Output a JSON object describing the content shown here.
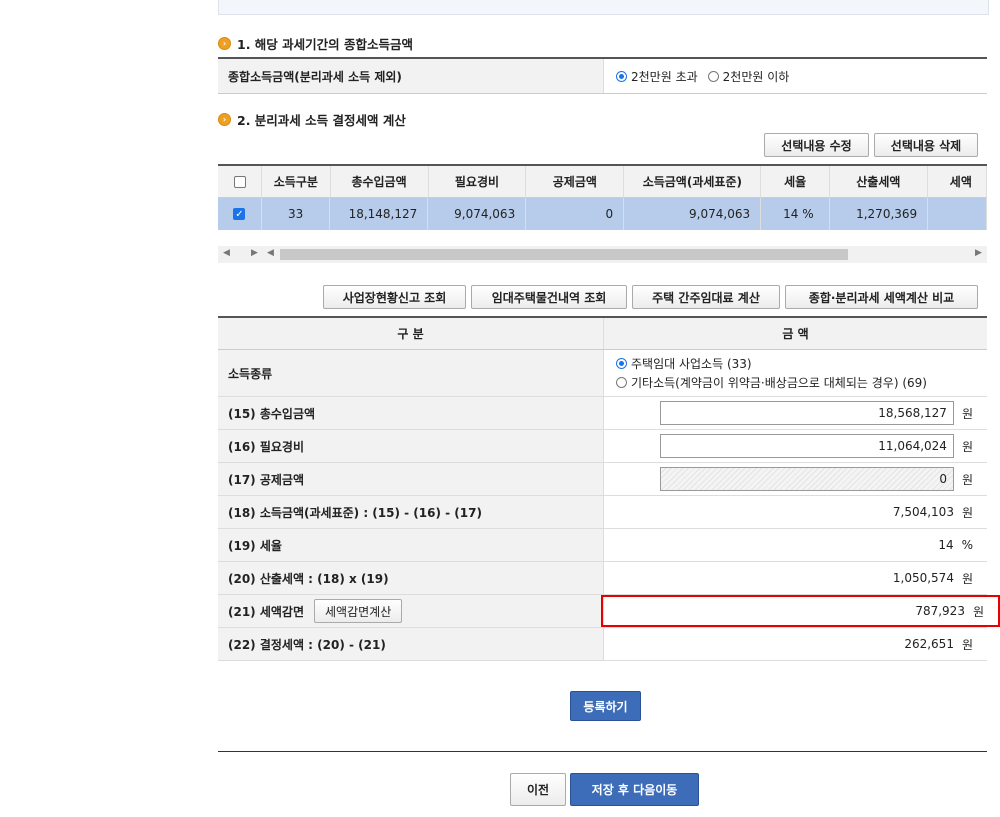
{
  "section1": {
    "title": "1. 해당 과세기간의 종합소득금액",
    "label": "종합소득금액(분리과세 소득 제외)",
    "options": [
      "2천만원 초과",
      "2천만원 이하"
    ]
  },
  "section2": {
    "title": "2. 분리과세 소득 결정세액 계산",
    "edit_label": "선택내용 수정",
    "delete_label": "선택내용 삭제",
    "columns": [
      "소득구분",
      "총수입금액",
      "필요경비",
      "공제금액",
      "소득금액(과세표준)",
      "세율",
      "산출세액",
      "세액"
    ],
    "row": [
      "33",
      "18,148,127",
      "9,074,063",
      "0",
      "9,074,063",
      "14 %",
      "1,270,369",
      ""
    ]
  },
  "actions": {
    "btn1": "사업장현황신고 조회",
    "btn2": "임대주택물건내역 조회",
    "btn3": "주택 간주임대료 계산",
    "btn4": "종합·분리과세 세액계산 비교"
  },
  "calc": {
    "head_left": "구 분",
    "head_right": "금 액",
    "income_type_label": "소득종류",
    "income_type_options": [
      "주택임대 사업소득 (33)",
      "기타소득(계약금이 위약금·배상금으로 대체되는 경우) (69)"
    ],
    "r15_label": "(15) 총수입금액",
    "r15_value": "18,568,127",
    "r16_label": "(16) 필요경비",
    "r16_value": "11,064,024",
    "r17_label": "(17) 공제금액",
    "r17_value": "0",
    "r18_label": "(18) 소득금액(과세표준) : (15) - (16) - (17)",
    "r18_value": "7,504,103",
    "r19_label": "(19) 세율",
    "r19_value": "14",
    "r19_unit": "%",
    "r20_label": "(20) 산출세액 : (18) x (19)",
    "r20_value": "1,050,574",
    "r21_label": "(21) 세액감면",
    "r21_button": "세액감면계산",
    "r21_value": "787,923",
    "r22_label": "(22) 결정세액 : (20) - (21)",
    "r22_value": "262,651",
    "unit": "원"
  },
  "footer": {
    "register": "등록하기",
    "prev": "이전",
    "save_next": "저장 후 다음이동"
  },
  "colors": {
    "highlight_border": "#e60000",
    "primary_button": "#3d6db8",
    "selected_row": "#b7ccea"
  }
}
